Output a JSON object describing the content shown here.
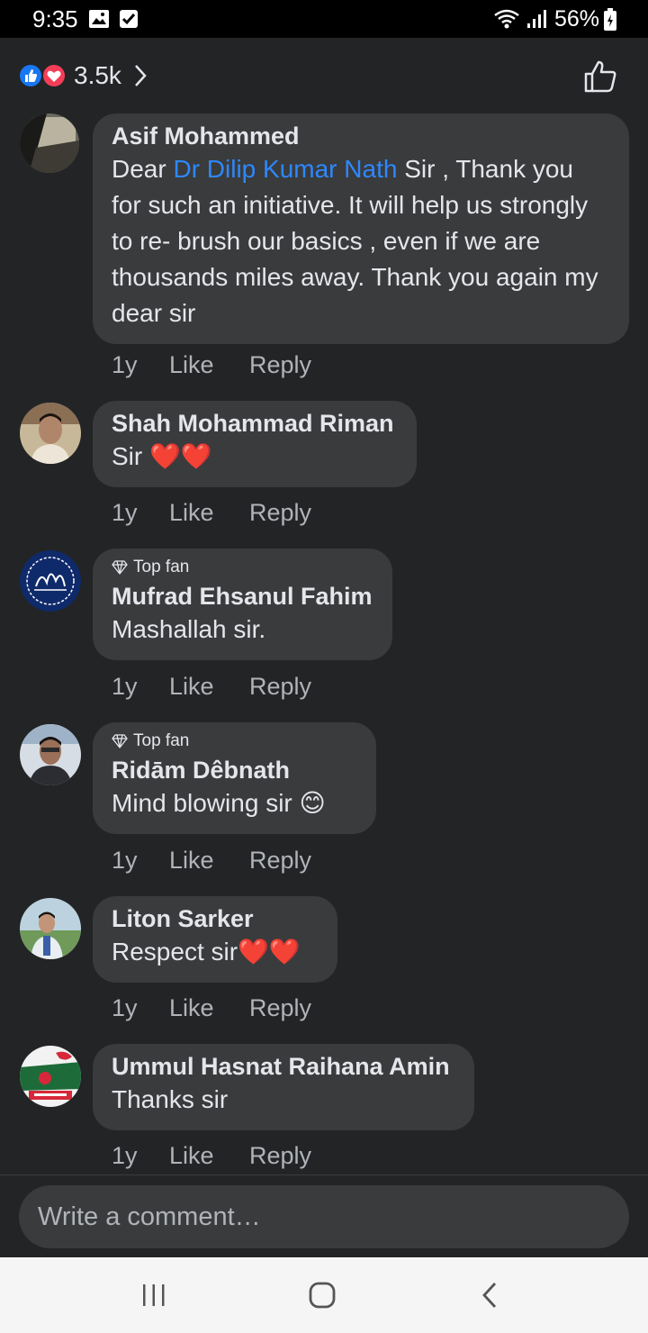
{
  "status_bar": {
    "time": "9:35",
    "battery": "56%"
  },
  "reactions": {
    "count": "3.5k"
  },
  "comments": [
    {
      "author": "Asif Mohammed",
      "text_before": "Dear ",
      "mention": "Dr Dilip Kumar Nath",
      "text_after": " Sir , Thank you for such an initiative. It will help us strongly to re- brush our basics , even if we are thousands miles away. Thank you again my dear sir",
      "time": "1y",
      "like": "Like",
      "reply": "Reply"
    },
    {
      "author": "Shah Mohammad Riman",
      "text": "Sir ❤️❤️",
      "time": "1y",
      "like": "Like",
      "reply": "Reply"
    },
    {
      "badge": "Top fan",
      "author": "Mufrad Ehsanul Fahim",
      "text": "Mashallah sir.",
      "time": "1y",
      "like": "Like",
      "reply": "Reply"
    },
    {
      "badge": "Top fan",
      "author": "Ridām Dêbnath",
      "text": "Mind blowing sir 😊",
      "time": "1y",
      "like": "Like",
      "reply": "Reply"
    },
    {
      "author": "Liton Sarker",
      "text": "Respect sir❤️❤️",
      "time": "1y",
      "like": "Like",
      "reply": "Reply"
    },
    {
      "author": "Ummul Hasnat Raihana Amin",
      "text": "Thanks sir",
      "time": "1y",
      "like": "Like",
      "reply": "Reply"
    }
  ],
  "composer": {
    "placeholder": "Write a comment…"
  },
  "icons": {
    "status": [
      "image-icon",
      "checkbox-icon",
      "wifi-icon",
      "signal-icon",
      "battery-icon"
    ],
    "header": [
      "like-reaction-icon",
      "love-reaction-icon",
      "chevron-right-icon",
      "thumbs-up-icon"
    ],
    "badge": "diamond-icon",
    "nav": [
      "recent-apps-icon",
      "home-icon",
      "back-icon"
    ]
  },
  "colors": {
    "background": "#232426",
    "bubble": "#3a3b3c",
    "mention": "#2d88ff",
    "like_reaction": "#1877f2",
    "love_reaction": "#f33e58"
  }
}
